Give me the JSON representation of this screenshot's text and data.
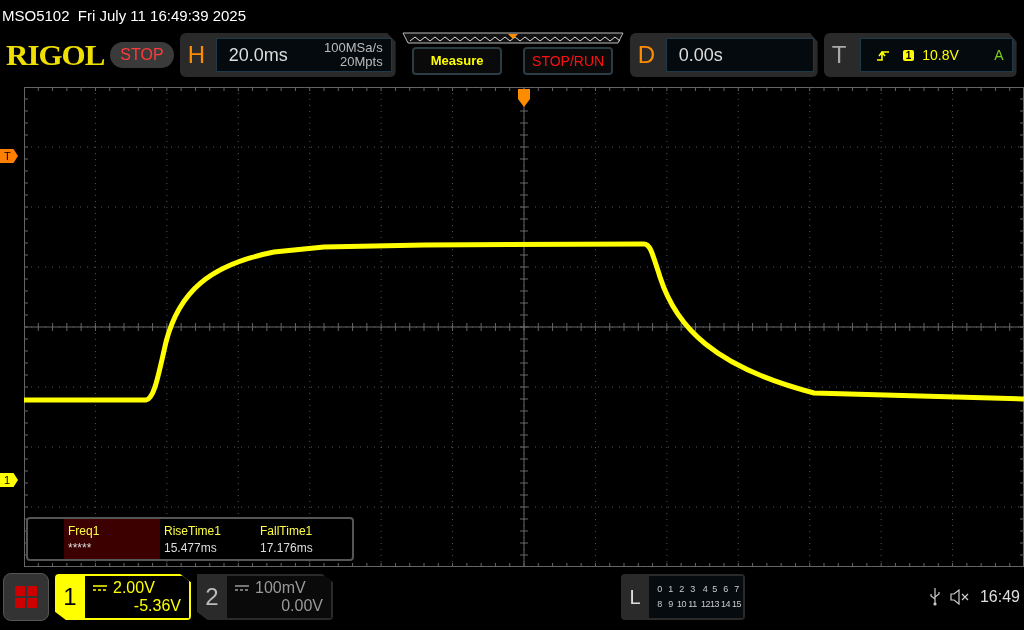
{
  "header": {
    "model": "MSO5102",
    "datetime": "Fri July 11 16:49:39 2025"
  },
  "logo": "RIGOL",
  "run_state": {
    "label": "STOP",
    "kind": "stop"
  },
  "horizontal": {
    "letter": "H",
    "timebase": "20.0ms",
    "sample_rate": "100MSa/s",
    "memory_depth": "20Mpts"
  },
  "buttons": [
    {
      "label": "Measure",
      "kind": "measure"
    },
    {
      "label": "STOP/RUN",
      "kind": "stoprun"
    }
  ],
  "delay": {
    "letter": "D",
    "value": "0.00s"
  },
  "trigger": {
    "letter": "T",
    "channel": "1",
    "level": "10.8V",
    "mode": "A"
  },
  "markers": {
    "trigger_level": "T",
    "channel": "1"
  },
  "measurements": [
    {
      "name": "Freq1",
      "value": "*****",
      "selected": true
    },
    {
      "name": "RiseTime1",
      "value": "15.477ms",
      "selected": false
    },
    {
      "name": "FallTime1",
      "value": "17.176ms",
      "selected": false
    }
  ],
  "channels": [
    {
      "number": "1",
      "scale": "2.00V",
      "offset": "-5.36V",
      "selected": true
    },
    {
      "number": "2",
      "scale": "100mV",
      "offset": "0.00V",
      "selected": false
    }
  ],
  "logic": {
    "letter": "L",
    "rows": [
      [
        "0",
        "1",
        "2",
        "3",
        "4",
        "5",
        "6",
        "7"
      ],
      [
        "8",
        "9",
        "10",
        "11",
        "12",
        "13",
        "14",
        "15"
      ]
    ]
  },
  "status": {
    "time": "16:49"
  }
}
